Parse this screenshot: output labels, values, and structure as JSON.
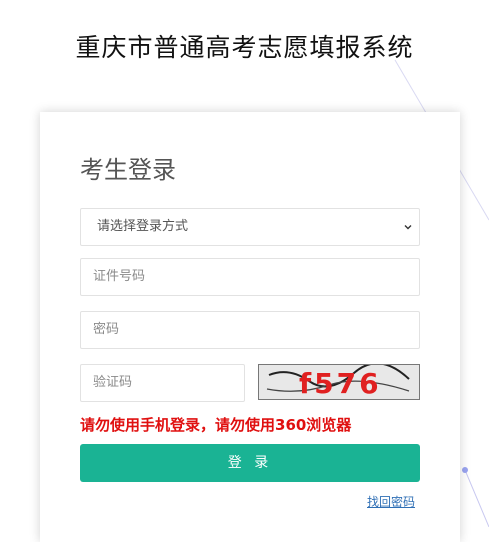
{
  "header": {
    "title": "重庆市普通高考志愿填报系统"
  },
  "login_card": {
    "title": "考生登录",
    "login_method": {
      "selected": "请选择登录方式"
    },
    "id_field": {
      "placeholder": "证件号码"
    },
    "password_field": {
      "placeholder": "密码"
    },
    "captcha_field": {
      "placeholder": "验证码"
    },
    "captcha_image": {
      "text": "f576"
    },
    "warning": "请勿使用手机登录，请勿使用360浏览器",
    "login_button": "登 录",
    "find_password_link": "找回密码"
  },
  "colors": {
    "primary_button": "#1ab394",
    "warning_text": "#e01010",
    "link": "#2f6fb5",
    "captcha_text": "#e02020"
  }
}
